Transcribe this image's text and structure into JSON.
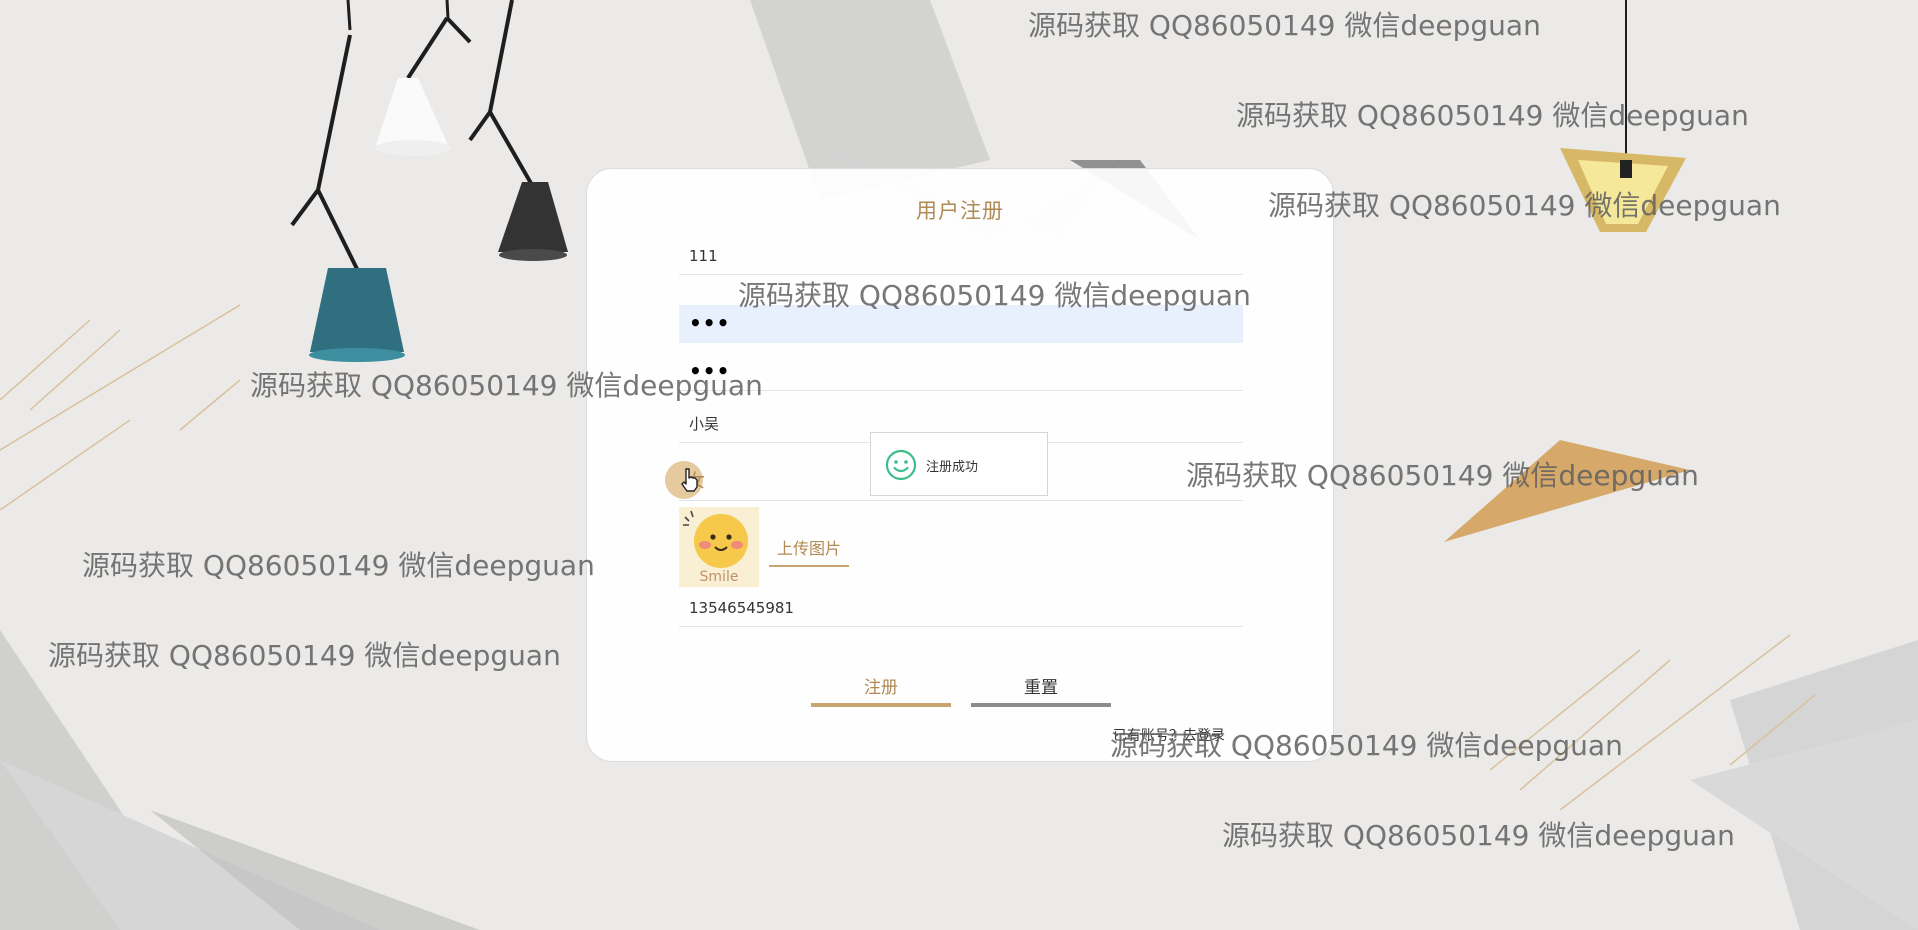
{
  "form": {
    "title": "用户注册",
    "account_value": "111",
    "password_mask": "•••",
    "confirm_mask": "•••",
    "name_value": "小吴",
    "gender_value": "女",
    "upload_label": "上传图片",
    "avatar_caption": "Smile",
    "phone_value": "13546545981",
    "register_label": "注册",
    "reset_label": "重置",
    "login_link": "已有账号？去登录"
  },
  "toast": {
    "message": "注册成功",
    "icon": "smile-icon"
  },
  "watermark": {
    "text": "源码获取 QQ86050149 微信deepguan"
  },
  "colors": {
    "accent": "#b08a54",
    "accent_line": "#c8a56e",
    "toast_icon": "#3bbd8c",
    "background": "#ebeae8",
    "focus_bg": "#e8f0fe"
  }
}
